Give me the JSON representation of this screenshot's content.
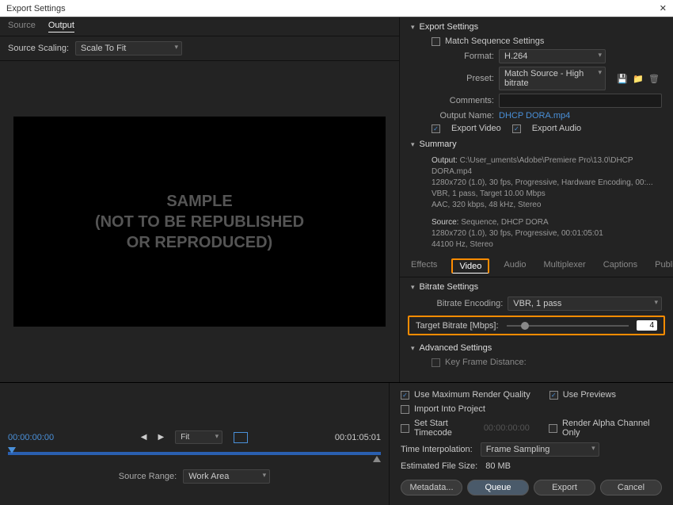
{
  "window": {
    "title": "Export Settings"
  },
  "left": {
    "tabs": {
      "source": "Source",
      "output": "Output"
    },
    "source_scaling_label": "Source Scaling:",
    "source_scaling_value": "Scale To Fit",
    "preview_text": "SAMPLE\n(NOT TO BE REPUBLISHED\nOR REPRODUCED)"
  },
  "export_settings": {
    "title": "Export Settings",
    "match_seq": "Match Sequence Settings",
    "format_label": "Format:",
    "format_value": "H.264",
    "preset_label": "Preset:",
    "preset_value": "Match Source - High bitrate",
    "comments_label": "Comments:",
    "output_name_label": "Output Name:",
    "output_name_value": "DHCP DORA.mp4",
    "export_video": "Export Video",
    "export_audio": "Export Audio"
  },
  "summary": {
    "title": "Summary",
    "output_label": "Output:",
    "output_line1": "C:\\User_uments\\Adobe\\Premiere Pro\\13.0\\DHCP DORA.mp4",
    "output_line2": "1280x720 (1.0), 30 fps, Progressive, Hardware Encoding, 00:...",
    "output_line3": "VBR, 1 pass, Target 10.00 Mbps",
    "output_line4": "AAC, 320 kbps, 48 kHz, Stereo",
    "source_label": "Source:",
    "source_line1": "Sequence, DHCP DORA",
    "source_line2": "1280x720 (1.0), 30 fps, Progressive, 00:01:05:01",
    "source_line3": "44100 Hz, Stereo"
  },
  "right_tabs": {
    "effects": "Effects",
    "video": "Video",
    "audio": "Audio",
    "multiplexer": "Multiplexer",
    "captions": "Captions",
    "publish": "Publish"
  },
  "bitrate": {
    "section": "Bitrate Settings",
    "encoding_label": "Bitrate Encoding:",
    "encoding_value": "VBR, 1 pass",
    "target_label": "Target Bitrate [Mbps]:",
    "target_value": "4"
  },
  "advanced": {
    "section": "Advanced Settings",
    "keyframe_label": "Key Frame Distance:"
  },
  "bottom": {
    "use_max_quality": "Use Maximum Render Quality",
    "use_previews": "Use Previews",
    "import_project": "Import Into Project",
    "set_start_tc": "Set Start Timecode",
    "start_tc_value": "00:00:00:00",
    "render_alpha": "Render Alpha Channel Only",
    "time_interp_label": "Time Interpolation:",
    "time_interp_value": "Frame Sampling",
    "est_size_label": "Estimated File Size:",
    "est_size_value": "80 MB",
    "metadata": "Metadata...",
    "queue": "Queue",
    "export": "Export",
    "cancel": "Cancel"
  },
  "timeline": {
    "in": "00:00:00:00",
    "out": "00:01:05:01",
    "fit": "Fit",
    "source_range_label": "Source Range:",
    "source_range_value": "Work Area"
  }
}
